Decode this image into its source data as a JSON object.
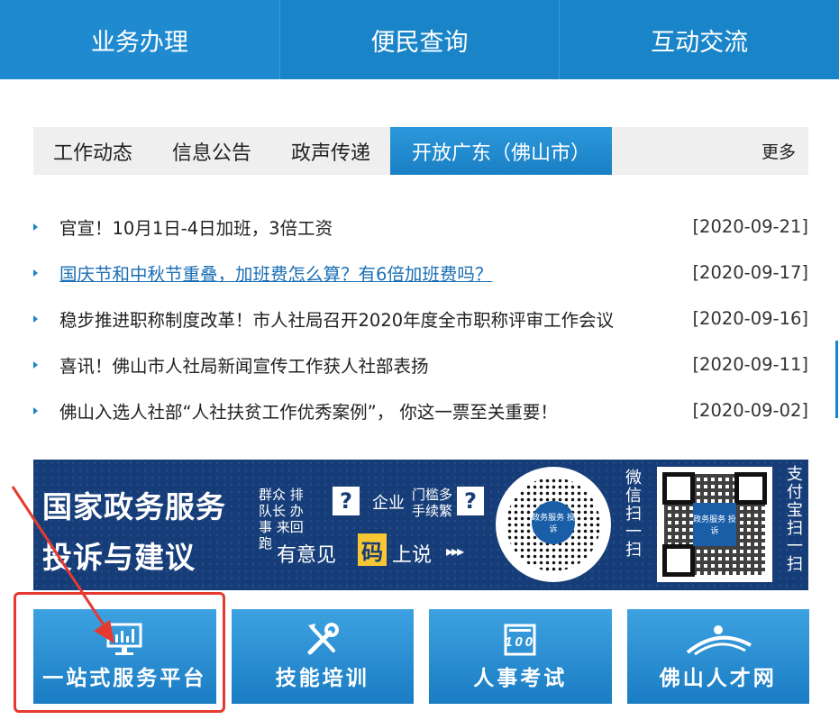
{
  "topnav": {
    "items": [
      "业务办理",
      "便民查询",
      "互动交流"
    ]
  },
  "tabs": {
    "items": [
      "工作动态",
      "信息公告",
      "政声传递",
      "开放广东（佛山市）"
    ],
    "active_index": 3,
    "more": "更多"
  },
  "news": [
    {
      "title": "官宣！10月1日-4日加班，3倍工资",
      "date": "[2020-09-21]",
      "link": false
    },
    {
      "title": "国庆节和中秋节重叠，加班费怎么算？有6倍加班费吗？",
      "date": "[2020-09-17]",
      "link": true
    },
    {
      "title": "稳步推进职称制度改革！市人社局召开2020年度全市职称评审工作会议",
      "date": "[2020-09-16]",
      "link": false
    },
    {
      "title": "喜讯！佛山市人社局新闻宣传工作获人社部表扬",
      "date": "[2020-09-11]",
      "link": false
    },
    {
      "title": "佛山入选人社部“人社扶贫工作优秀案例”， 你这一票至关重要！",
      "date": "[2020-09-02]",
      "link": false
    }
  ],
  "banner": {
    "line1": "国家政务服务",
    "line2": "投诉与建议",
    "slogan_a": "群众 排队长 办事 来回跑",
    "slogan_b": "企业",
    "slogan_c": "门槛多 手续繁",
    "q": "?",
    "say1": "有意见",
    "ma": "码",
    "say2": "上说",
    "arrows": "▸▸▸",
    "wechat": "微信扫一扫",
    "alipay": "支付宝扫一扫",
    "qr_label": "政务服务 投诉"
  },
  "tiles": [
    {
      "label": "一站式服务平台",
      "icon": "monitor-chart-icon"
    },
    {
      "label": "技能培训",
      "icon": "tools-icon"
    },
    {
      "label": "人事考试",
      "icon": "exam-100-icon"
    },
    {
      "label": "佛山人才网",
      "icon": "talent-logo-icon"
    }
  ],
  "colors": {
    "primary": "#1a84c8",
    "annotation": "#e53a30",
    "banner": "#173d78"
  }
}
